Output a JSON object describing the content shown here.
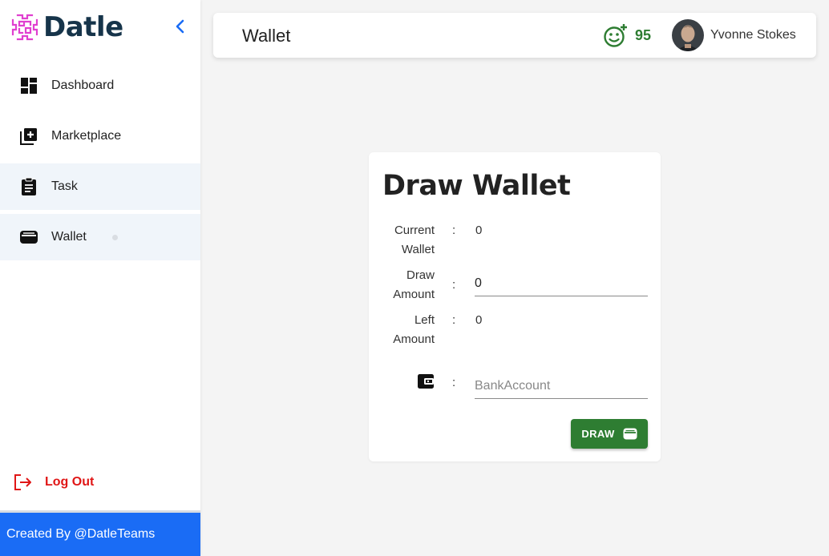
{
  "brand": {
    "name": "Datle"
  },
  "sidebar": {
    "items": [
      {
        "label": "Dashboard",
        "icon": "dashboard-icon"
      },
      {
        "label": "Marketplace",
        "icon": "add-box-icon"
      },
      {
        "label": "Task",
        "icon": "clipboard-icon"
      },
      {
        "label": "Wallet",
        "icon": "wallet-icon"
      }
    ],
    "logout_label": "Log Out",
    "footer_text": "Created By @DatleTeams"
  },
  "header": {
    "title": "Wallet",
    "score": "95",
    "user_name": "Yvonne Stokes"
  },
  "card": {
    "title": "Draw Wallet",
    "current_wallet_label_1": "Current",
    "current_wallet_label_2": "Wallet",
    "current_wallet_value": "0",
    "draw_amount_label_1": "Draw",
    "draw_amount_label_2": "Amount",
    "draw_amount_value": "0",
    "left_amount_label_1": "Left",
    "left_amount_label_2": "Amount",
    "left_amount_value": "0",
    "colon": ":",
    "bank_placeholder": "BankAccount",
    "draw_button": "DRAW"
  },
  "colors": {
    "accent_green": "#2e7d32",
    "footer_blue": "#1a6cf5",
    "logout_red": "#e01616",
    "brand_navy": "#16344a",
    "logo_magenta": "#e040d0"
  }
}
